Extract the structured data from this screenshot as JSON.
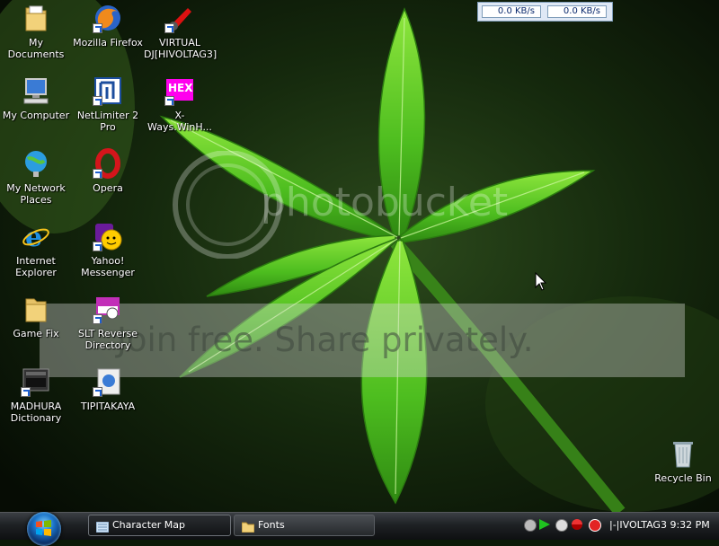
{
  "desktop": {
    "icons": [
      {
        "label": "My Documents"
      },
      {
        "label": "Mozilla Firefox"
      },
      {
        "label": "VIRTUAL DJ[HIVOLTAG3]"
      },
      {
        "label": "My Computer"
      },
      {
        "label": "NetLimiter 2 Pro"
      },
      {
        "label": "X-Ways.WinH..."
      },
      {
        "label": "My Network Places"
      },
      {
        "label": "Opera"
      },
      {
        "label": "Internet Explorer"
      },
      {
        "label": "Yahoo! Messenger"
      },
      {
        "label": "Game Fix"
      },
      {
        "label": "SLT Reverse Directory"
      },
      {
        "label": "MADHURA Dictionary"
      },
      {
        "label": "TIPITAKAYA"
      },
      {
        "label": "Recycle Bin"
      }
    ]
  },
  "net_meter": {
    "download": "0.0 KB/s",
    "upload": "0.0 KB/s"
  },
  "watermark": {
    "logo_text": "photobucket",
    "band_text": "Join free. Share privately."
  },
  "taskbar": {
    "buttons": [
      {
        "label": "Character Map"
      },
      {
        "label": "Fonts"
      }
    ],
    "clock": "|-|IVOLTAG3 9:32 PM"
  },
  "colors": {
    "accent": "#1b74c9",
    "leaf": "#5fd12a"
  }
}
